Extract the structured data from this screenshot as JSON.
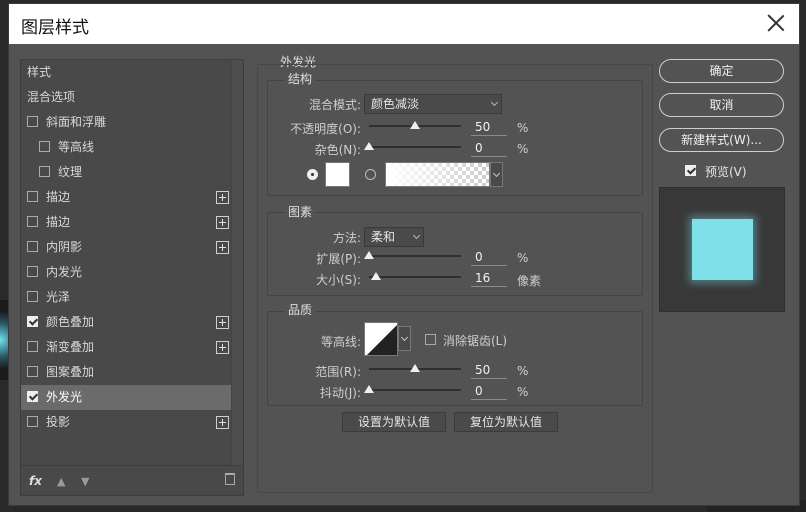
{
  "window": {
    "title": "图层样式"
  },
  "sidebar": {
    "items": [
      {
        "label": "样式",
        "checkbox": false,
        "plus": false,
        "sub": false
      },
      {
        "label": "混合选项",
        "checkbox": false,
        "plus": false,
        "sub": false
      },
      {
        "label": "斜面和浮雕",
        "checkbox": true,
        "checked": false,
        "plus": false,
        "sub": false
      },
      {
        "label": "等高线",
        "checkbox": true,
        "checked": false,
        "plus": false,
        "sub": true
      },
      {
        "label": "纹理",
        "checkbox": true,
        "checked": false,
        "plus": false,
        "sub": true
      },
      {
        "label": "描边",
        "checkbox": true,
        "checked": false,
        "plus": true,
        "sub": false
      },
      {
        "label": "描边",
        "checkbox": true,
        "checked": false,
        "plus": true,
        "sub": false
      },
      {
        "label": "内阴影",
        "checkbox": true,
        "checked": false,
        "plus": true,
        "sub": false
      },
      {
        "label": "内发光",
        "checkbox": true,
        "checked": false,
        "plus": false,
        "sub": false
      },
      {
        "label": "光泽",
        "checkbox": true,
        "checked": false,
        "plus": false,
        "sub": false
      },
      {
        "label": "颜色叠加",
        "checkbox": true,
        "checked": true,
        "plus": true,
        "sub": false
      },
      {
        "label": "渐变叠加",
        "checkbox": true,
        "checked": false,
        "plus": true,
        "sub": false
      },
      {
        "label": "图案叠加",
        "checkbox": true,
        "checked": false,
        "plus": false,
        "sub": false
      },
      {
        "label": "外发光",
        "checkbox": true,
        "checked": true,
        "plus": false,
        "sub": false,
        "selected": true
      },
      {
        "label": "投影",
        "checkbox": true,
        "checked": false,
        "plus": true,
        "sub": false
      }
    ],
    "fx_label": "fx"
  },
  "panel": {
    "title": "外发光",
    "structure": {
      "title": "结构",
      "blend_mode_label": "混合模式:",
      "blend_mode_value": "颜色减淡",
      "opacity_label": "不透明度(O):",
      "opacity_value": "50",
      "opacity_percent": 0.5,
      "noise_label": "杂色(N):",
      "noise_value": "0",
      "noise_percent": 0,
      "unit_percent": "%",
      "swatch_color": "#ffffff"
    },
    "elements": {
      "title": "图素",
      "method_label": "方法:",
      "method_value": "柔和",
      "spread_label": "扩展(P):",
      "spread_value": "0",
      "spread_percent": 0,
      "size_label": "大小(S):",
      "size_value": "16",
      "size_fraction": 0.08,
      "size_unit": "像素"
    },
    "quality": {
      "title": "品质",
      "contour_label": "等高线:",
      "antialias_label": "消除锯齿(L)",
      "range_label": "范围(R):",
      "range_value": "50",
      "range_percent": 0.5,
      "jitter_label": "抖动(J):",
      "jitter_value": "0",
      "jitter_percent": 0
    },
    "set_default": "设置为默认值",
    "reset_default": "复位为默认值"
  },
  "right": {
    "ok": "确定",
    "cancel": "取消",
    "new_style": "新建样式(W)...",
    "preview_label": "预览(V)",
    "preview_color": "#7fe0ea"
  }
}
